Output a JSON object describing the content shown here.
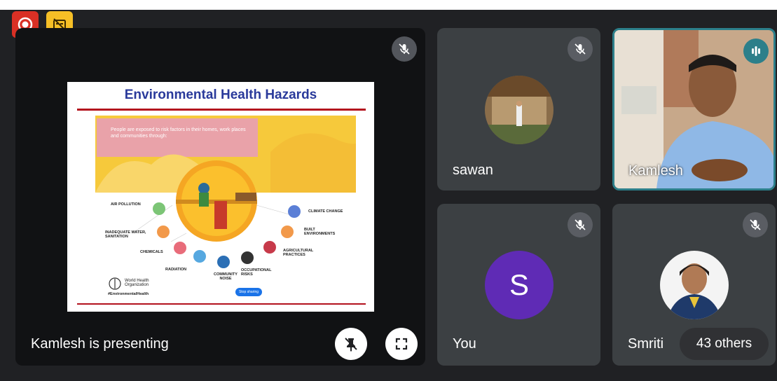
{
  "presenting_label": "Kamlesh is presenting",
  "slide": {
    "title": "Environmental Health Hazards",
    "intro": "People are exposed to risk factors in their homes, work places and communities through:",
    "hazards_left": [
      "AIR POLLUTION",
      "INADEQUATE WATER, SANITATION",
      "CHEMICALS",
      "RADIATION",
      "COMMUNITY NOISE"
    ],
    "hazards_right": [
      "CLIMATE CHANGE",
      "BUILT ENVIRONMENTS",
      "AGRICULTURAL PRACTICES",
      "OCCUPATIONAL RISKS"
    ],
    "org_name": "World Health Organization",
    "hashtag": "#EnvironmentalHealth",
    "footer_link": "Stop sharing"
  },
  "participants": {
    "sawan": "sawan",
    "kamlesh": "Kamlesh",
    "you": "You",
    "you_initial": "S",
    "smriti": "Smriti",
    "others": "43 others"
  },
  "colors": {
    "accent": "#2c7f8a",
    "record": "#d93025",
    "warn": "#f6bf26",
    "you_avatar": "#5f2bb5"
  }
}
